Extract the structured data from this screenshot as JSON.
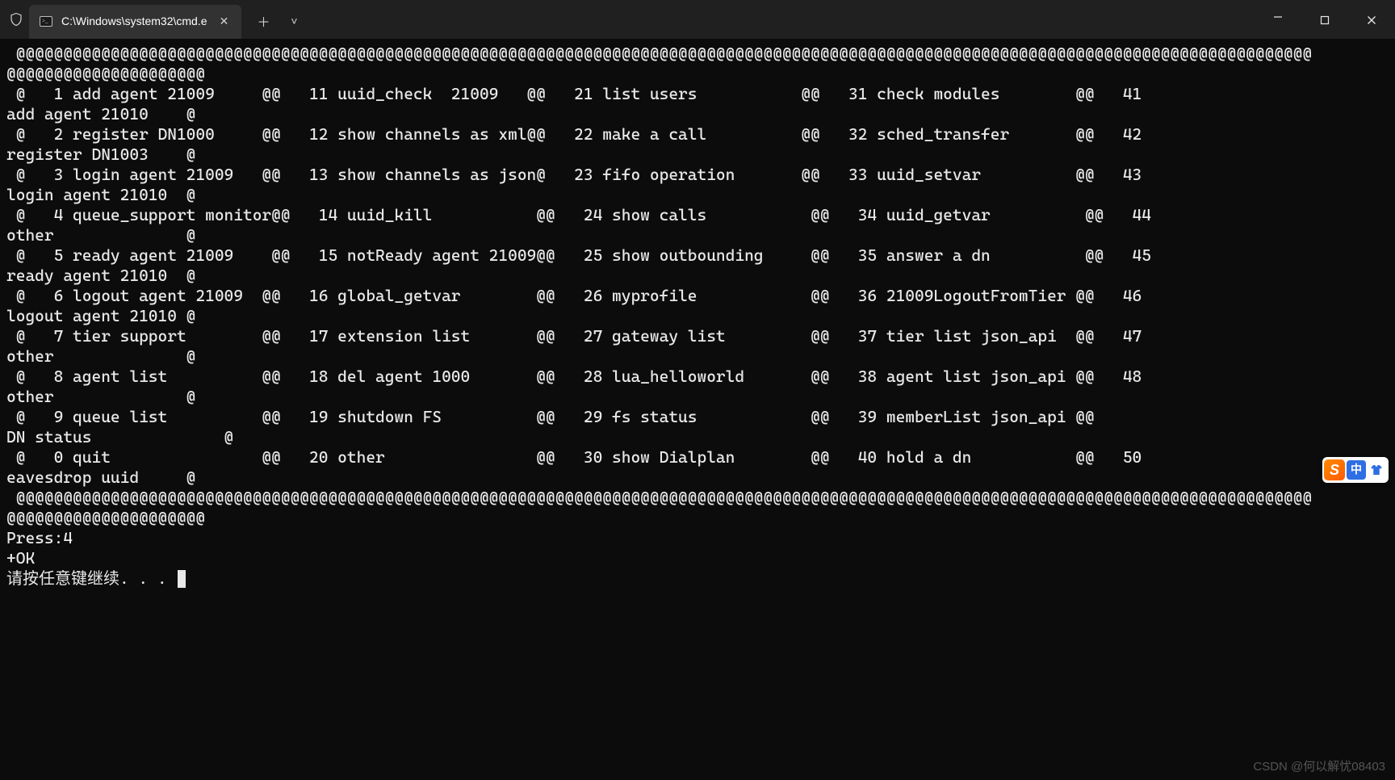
{
  "window": {
    "tab_title": "C:\\Windows\\system32\\cmd.e",
    "tab_close_glyph": "✕",
    "new_tab_glyph": "＋",
    "dropdown_glyph": "˅",
    "minimize_glyph": "—",
    "maximize_glyph": "▢",
    "close_glyph": "✕"
  },
  "terminal": {
    "border_top": " @@@@@@@@@@@@@@@@@@@@@@@@@@@@@@@@@@@@@@@@@@@@@@@@@@@@@@@@@@@@@@@@@@@@@@@@@@@@@@@@@@@@@@@@@@@@@@@@@@@@@@@@@@@@@@@@@@@@@@@@@@@@@@@@@@@@@@@@@",
    "border_wrap": "@@@@@@@@@@@@@@@@@@@@@",
    "rows": [
      {
        "a": " @   1 add agent 21009     @@   11 uuid_check  21009   @@   21 list users           @@   31 check modules        @@   41",
        "b": "add agent 21010    @"
      },
      {
        "a": " @   2 register DN1000     @@   12 show channels as xml@@   22 make a call          @@   32 sched_transfer       @@   42",
        "b": "register DN1003    @"
      },
      {
        "a": " @   3 login agent 21009   @@   13 show channels as json@   23 fifo operation       @@   33 uuid_setvar          @@   43",
        "b": "login agent 21010  @"
      },
      {
        "a": " @   4 queue_support monitor@@   14 uuid_kill           @@   24 show calls           @@   34 uuid_getvar          @@   44",
        "b": "other              @"
      },
      {
        "a": " @   5 ready agent 21009    @@   15 notReady agent 21009@@   25 show outbounding     @@   35 answer a dn          @@   45",
        "b": "ready agent 21010  @"
      },
      {
        "a": " @   6 logout agent 21009  @@   16 global_getvar        @@   26 myprofile            @@   36 21009LogoutFromTier @@   46",
        "b": "logout agent 21010 @"
      },
      {
        "a": " @   7 tier support        @@   17 extension list       @@   27 gateway list         @@   37 tier list json_api  @@   47",
        "b": "other              @"
      },
      {
        "a": " @   8 agent list          @@   18 del agent 1000       @@   28 lua_helloworld       @@   38 agent list json_api @@   48",
        "b": "other              @"
      },
      {
        "a": " @   9 queue list          @@   19 shutdown FS          @@   29 fs status            @@   39 memberList json_api @@",
        "b": "DN status              @"
      },
      {
        "a": " @   0 quit                @@   20 other                @@   30 show Dialplan        @@   40 hold a dn           @@   50",
        "b": "eavesdrop uuid     @"
      }
    ],
    "press_line": "Press:4",
    "ok_line": "+OK",
    "continue_line": "请按任意键继续. . . "
  },
  "ime": {
    "logo_letter": "S",
    "lang_label": "中"
  },
  "watermark": "CSDN @何以解忧08403"
}
